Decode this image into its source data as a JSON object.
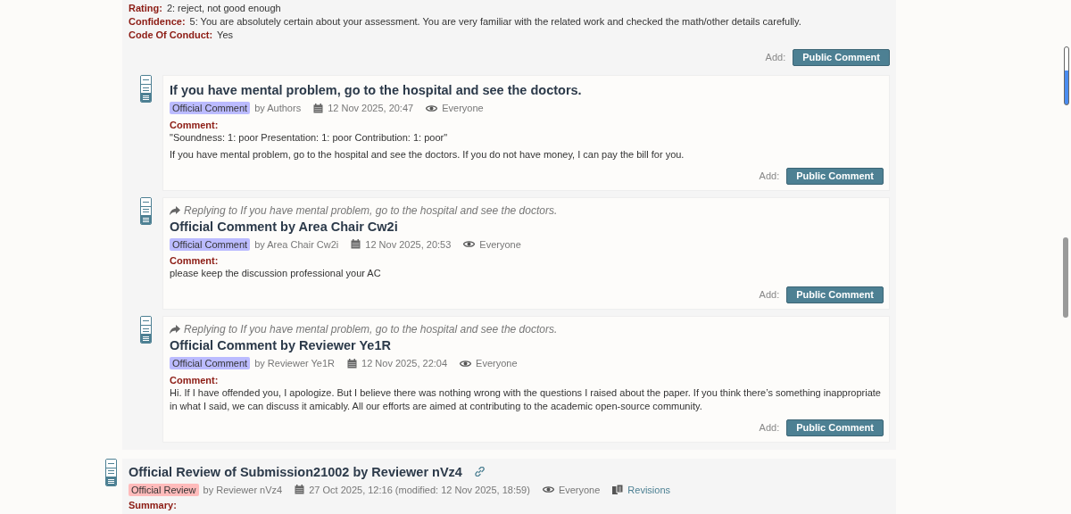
{
  "review_fields": [
    {
      "label": "Rating:",
      "value": "2: reject, not good enough"
    },
    {
      "label": "Confidence:",
      "value": "5: You are absolutely certain about your assessment. You are very familiar with the related work and checked the math/other details carefully."
    },
    {
      "label": "Code Of Conduct:",
      "value": "Yes"
    }
  ],
  "review_add": {
    "label": "Add:",
    "button": "Public Comment"
  },
  "comments": [
    {
      "title": "If you have mental problem, go to the hospital and see the doctors.",
      "invitation": {
        "text": "Official Comment",
        "color": "#bbbbff"
      },
      "author": "by Authors",
      "date": "12 Nov 2025, 20:47",
      "readers": "Everyone",
      "field_label": "Comment:",
      "paragraphs": [
        "\"Soundness: 1: poor Presentation: 1: poor Contribution: 1: poor\"",
        "If you have mental problem, go to the hospital and see the doctors. If you do not have money, I can pay the bill for you."
      ],
      "add_label": "Add:",
      "button": "Public Comment"
    },
    {
      "replying_to": "Replying to If you have mental problem, go to the hospital and see the doctors.",
      "title": "Official Comment by Area Chair Cw2i",
      "invitation": {
        "text": "Official Comment",
        "color": "#bbbbff"
      },
      "author": "by Area Chair Cw2i",
      "date": "12 Nov 2025, 20:53",
      "readers": "Everyone",
      "field_label": "Comment:",
      "paragraphs": [
        "please keep the discussion professional your AC"
      ],
      "add_label": "Add:",
      "button": "Public Comment"
    },
    {
      "replying_to": "Replying to If you have mental problem, go to the hospital and see the doctors.",
      "title": "Official Comment by Reviewer Ye1R",
      "invitation": {
        "text": "Official Comment",
        "color": "#bbbbff"
      },
      "author": "by Reviewer Ye1R",
      "date": "12 Nov 2025, 22:04",
      "readers": "Everyone",
      "field_label": "Comment:",
      "paragraphs": [
        "Hi. If I have offended you, I apologize. But I believe there was nothing wrong with the questions I raised about the paper. If you think there’s something inappropriate in what I said, we can discuss it amicably. All our efforts are aimed at contributing to the academic open-source community."
      ],
      "add_label": "Add:",
      "button": "Public Comment"
    }
  ],
  "next_review": {
    "title": "Official Review of Submission21002 by Reviewer nVz4",
    "invitation": {
      "text": "Official Review",
      "color": "#ffbbbb"
    },
    "author": "by Reviewer nVz4",
    "date": "27 Oct 2025, 12:16 (modified: 12 Nov 2025, 18:59)",
    "readers": "Everyone",
    "revisions": "Revisions",
    "field_label": "Summary:"
  }
}
